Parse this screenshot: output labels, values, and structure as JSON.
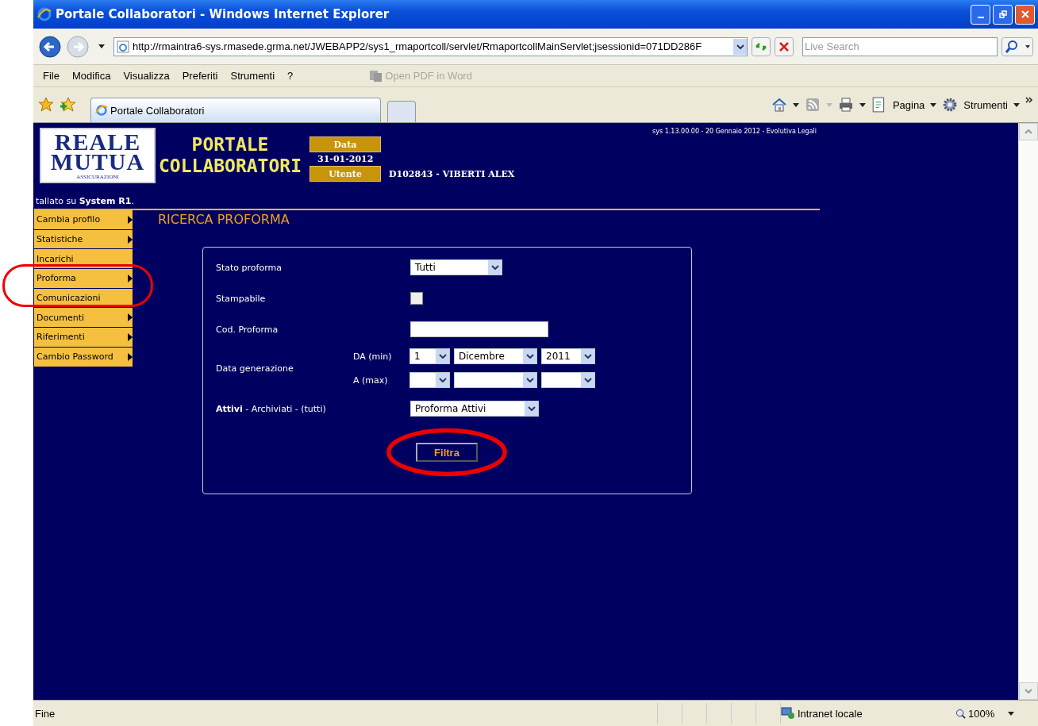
{
  "window": {
    "title": "Portale Collaboratori - Windows Internet Explorer"
  },
  "nav": {
    "address": "http://rmaintra6-sys.rmasede.grma.net/JWEBAPP2/sys1_rmaportcoll/servlet/RmaportcollMainServlet;jsessionid=071DD286F",
    "search_placeholder": "Live Search"
  },
  "menu": [
    "File",
    "Modifica",
    "Visualizza",
    "Preferiti",
    "Strumenti",
    "?"
  ],
  "pdf_button": {
    "label": "Open PDF in Word",
    "disabled": true
  },
  "tabs": [
    {
      "label": "Portale Collaboratori",
      "selected": true
    }
  ],
  "command_bar": [
    "Pagina",
    "Strumenti"
  ],
  "page": {
    "logo": [
      "REALE",
      "MUTUA",
      "ASSICURAZIONI"
    ],
    "portal_title": [
      "PORTALE",
      "COLLABORATORI"
    ],
    "date_label": "Data",
    "date": "31-01-2012",
    "user_label": "Utente",
    "user": "D102843 - VIBERTI ALEX",
    "version": "sys 1.13.00.00 - 20 Gennaio 2012 - Evolutiva Legali",
    "installed": "tallato su **System R1**.",
    "sidebar": [
      {
        "label": "Cambia profilo",
        "submenu": true
      },
      {
        "label": "Statistiche",
        "submenu": true
      },
      {
        "label": "Incarichi",
        "submenu": false
      },
      {
        "label": "Proforma",
        "submenu": true
      },
      {
        "label": "Comunicazioni",
        "submenu": false
      },
      {
        "label": "Documenti",
        "submenu": true
      },
      {
        "label": "Riferimenti",
        "submenu": true
      },
      {
        "label": "Cambio Password",
        "submenu": true
      }
    ],
    "heading": "RICERCA PROFORMA",
    "form": [
      {
        "kind": "select",
        "label": "Stato proforma",
        "value": "Tutti"
      },
      {
        "kind": "checkbox",
        "label": "Stampabile",
        "checked": false
      },
      {
        "kind": "text",
        "label": "Cod. Proforma"
      },
      {
        "kind": "date_range",
        "label": "Data generazione",
        "rows": [
          {
            "label": "DA (min)",
            "day": "1",
            "month": "Dicembre",
            "year": "2011"
          },
          {
            "label": "A (max)"
          }
        ]
      },
      {
        "kind": "select",
        "label": "**Attivi** - Archiviati - (tutti)",
        "value": "Proforma Attivi"
      }
    ],
    "button": "Filtra"
  },
  "status_bar": {
    "text": "Fine",
    "zone": "Intranet locale",
    "zoom": "100%"
  }
}
